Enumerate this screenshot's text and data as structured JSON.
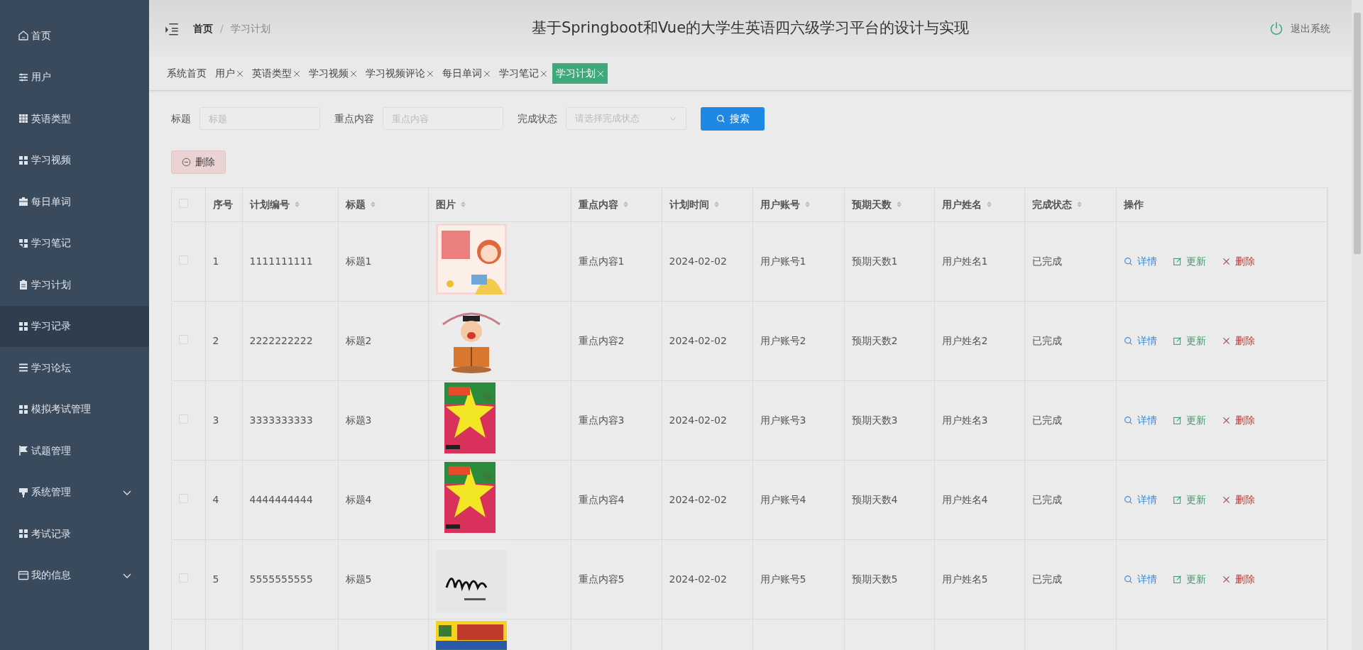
{
  "sidebar": {
    "items": [
      {
        "label": "首页",
        "hovered": false,
        "expandable": false
      },
      {
        "label": "用户",
        "hovered": false,
        "expandable": false
      },
      {
        "label": "英语类型",
        "hovered": false,
        "expandable": false
      },
      {
        "label": "学习视频",
        "hovered": false,
        "expandable": false
      },
      {
        "label": "每日单词",
        "hovered": false,
        "expandable": false
      },
      {
        "label": "学习笔记",
        "hovered": false,
        "expandable": false
      },
      {
        "label": "学习计划",
        "hovered": false,
        "expandable": false
      },
      {
        "label": "学习记录",
        "hovered": true,
        "expandable": false
      },
      {
        "label": "学习论坛",
        "hovered": false,
        "expandable": false
      },
      {
        "label": "模拟考试管理",
        "hovered": false,
        "expandable": false
      },
      {
        "label": "试题管理",
        "hovered": false,
        "expandable": false
      },
      {
        "label": "系统管理",
        "hovered": false,
        "expandable": true
      },
      {
        "label": "考试记录",
        "hovered": false,
        "expandable": false
      },
      {
        "label": "我的信息",
        "hovered": false,
        "expandable": true
      }
    ]
  },
  "header": {
    "breadcrumb": [
      "首页",
      "学习计划"
    ],
    "breadcrumb_separator": "/",
    "title": "基于Springboot和Vue的大学生英语四六级学习平台的设计与实现",
    "logout": "退出系统"
  },
  "tabs": [
    {
      "label": "系统首页",
      "closable": false,
      "selected": false
    },
    {
      "label": "用户",
      "closable": true,
      "selected": false
    },
    {
      "label": "英语类型",
      "closable": true,
      "selected": false
    },
    {
      "label": "学习视频",
      "closable": true,
      "selected": false
    },
    {
      "label": "学习视频评论",
      "closable": true,
      "selected": false
    },
    {
      "label": "每日单词",
      "closable": true,
      "selected": false
    },
    {
      "label": "学习笔记",
      "closable": true,
      "selected": false
    },
    {
      "label": "学习计划",
      "closable": true,
      "selected": true
    }
  ],
  "search": {
    "fields": [
      {
        "kind": "text",
        "label": "标题",
        "placeholder": "标题"
      },
      {
        "kind": "text",
        "label": "重点内容",
        "placeholder": "重点内容"
      },
      {
        "kind": "select",
        "label": "完成状态",
        "placeholder": "请选择完成状态"
      }
    ],
    "button": "搜索"
  },
  "delete_button": "删除",
  "table": {
    "all_checked": false,
    "columns": [
      {
        "label": "序号",
        "sortable": false
      },
      {
        "label": "计划编号",
        "sortable": true
      },
      {
        "label": "标题",
        "sortable": true
      },
      {
        "label": "图片",
        "sortable": true
      },
      {
        "label": "重点内容",
        "sortable": true
      },
      {
        "label": "计划时间",
        "sortable": true
      },
      {
        "label": "用户账号",
        "sortable": true
      },
      {
        "label": "预期天数",
        "sortable": true
      },
      {
        "label": "用户姓名",
        "sortable": true
      },
      {
        "label": "完成状态",
        "sortable": true
      },
      {
        "label": "操作",
        "sortable": false
      }
    ],
    "rows": [
      {
        "checked": false,
        "cells": [
          "1",
          "1111111111",
          "标题1",
          {
            "kind": "picture"
          },
          "重点内容1",
          "2024-02-02",
          "用户账号1",
          "预期天数1",
          "用户姓名1",
          "已完成"
        ],
        "actions": [
          "详情",
          "更新",
          "删除"
        ]
      },
      {
        "checked": false,
        "cells": [
          "2",
          "2222222222",
          "标题2",
          {
            "kind": "picture"
          },
          "重点内容2",
          "2024-02-02",
          "用户账号2",
          "预期天数2",
          "用户姓名2",
          "已完成"
        ],
        "actions": [
          "详情",
          "更新",
          "删除"
        ]
      },
      {
        "checked": false,
        "cells": [
          "3",
          "3333333333",
          "标题3",
          {
            "kind": "picture"
          },
          "重点内容3",
          "2024-02-02",
          "用户账号3",
          "预期天数3",
          "用户姓名3",
          "已完成"
        ],
        "actions": [
          "详情",
          "更新",
          "删除"
        ]
      },
      {
        "checked": false,
        "cells": [
          "4",
          "4444444444",
          "标题4",
          {
            "kind": "picture"
          },
          "重点内容4",
          "2024-02-02",
          "用户账号4",
          "预期天数4",
          "用户姓名4",
          "已完成"
        ],
        "actions": [
          "详情",
          "更新",
          "删除"
        ]
      },
      {
        "checked": false,
        "cells": [
          "5",
          "5555555555",
          "标题5",
          {
            "kind": "picture"
          },
          "重点内容5",
          "2024-02-02",
          "用户账号5",
          "预期天数5",
          "用户姓名5",
          "已完成"
        ],
        "actions": [
          "详情",
          "更新",
          "删除"
        ]
      },
      {
        "cells": [
          null,
          null,
          null,
          {
            "kind": "picture"
          }
        ]
      }
    ]
  }
}
